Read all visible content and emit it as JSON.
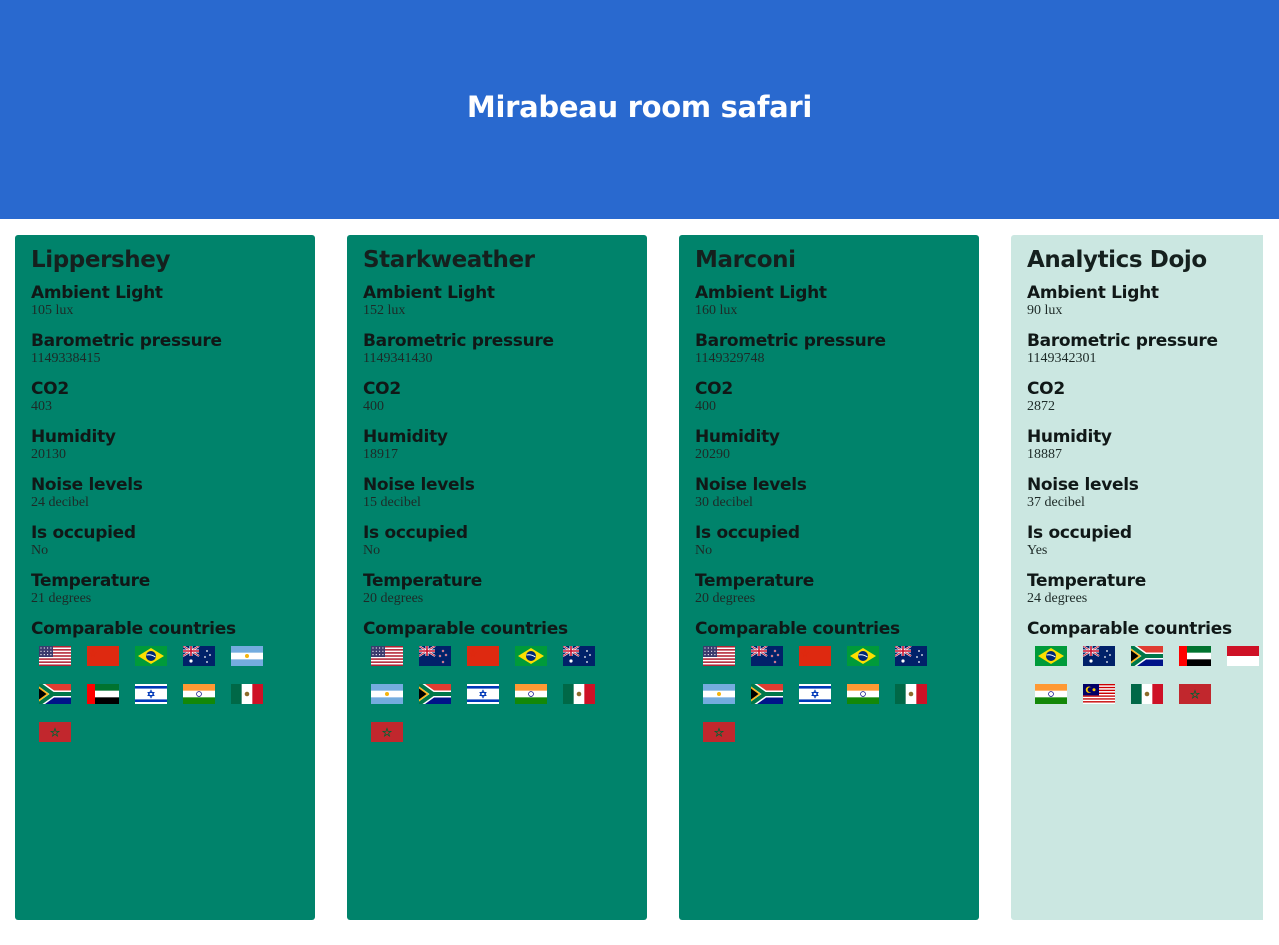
{
  "page": {
    "title": "Mirabeau room safari"
  },
  "metric_labels": {
    "light": "Ambient Light",
    "pressure": "Barometric pressure",
    "co2": "CO2",
    "humidity": "Humidity",
    "noise": "Noise levels",
    "occupied": "Is occupied",
    "temperature": "Temperature",
    "countries": "Comparable countries"
  },
  "rooms": [
    {
      "name": "Lippershey",
      "light": "105 lux",
      "pressure": "1149338415",
      "co2": "403",
      "humidity": "20130",
      "noise": "24 decibel",
      "occupied": "No",
      "temperature": "21 degrees",
      "flags": [
        "us",
        "cn",
        "br",
        "au",
        "ar",
        "za",
        "ae",
        "il",
        "in",
        "mx",
        "ma"
      ]
    },
    {
      "name": "Starkweather",
      "light": "152 lux",
      "pressure": "1149341430",
      "co2": "400",
      "humidity": "18917",
      "noise": "15 decibel",
      "occupied": "No",
      "temperature": "20 degrees",
      "flags": [
        "us",
        "nz",
        "cn",
        "br",
        "au",
        "ar",
        "za",
        "il",
        "in",
        "mx",
        "ma"
      ]
    },
    {
      "name": "Marconi",
      "light": "160 lux",
      "pressure": "1149329748",
      "co2": "400",
      "humidity": "20290",
      "noise": "30 decibel",
      "occupied": "No",
      "temperature": "20 degrees",
      "flags": [
        "us",
        "nz",
        "cn",
        "br",
        "au",
        "ar",
        "za",
        "il",
        "in",
        "mx",
        "ma"
      ]
    },
    {
      "name": "Analytics Dojo",
      "light": "90 lux",
      "pressure": "1149342301",
      "co2": "2872",
      "humidity": "18887",
      "noise": "37 decibel",
      "occupied": "Yes",
      "temperature": "24 degrees",
      "flags": [
        "br",
        "au",
        "za",
        "ae",
        "id",
        "in",
        "my",
        "mx",
        "ma"
      ]
    }
  ],
  "colors": {
    "header": "#2969cf",
    "card_unoccupied": "#00836b",
    "card_occupied": "#cbe7e1"
  }
}
